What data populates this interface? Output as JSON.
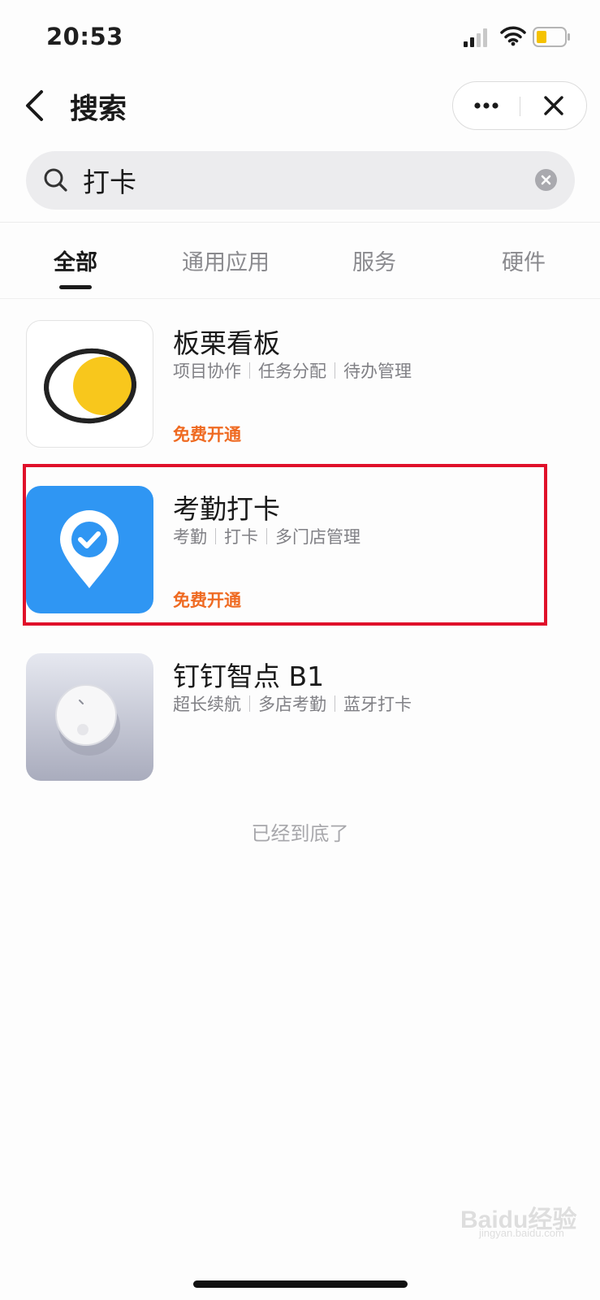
{
  "status_bar": {
    "time": "20:53",
    "battery_color": "#f5c200"
  },
  "nav": {
    "title": "搜索",
    "more_icon": "ellipsis-icon",
    "close_icon": "close-icon"
  },
  "search": {
    "query": "打卡",
    "placeholder": ""
  },
  "tabs": [
    {
      "label": "全部",
      "active": true
    },
    {
      "label": "通用应用",
      "active": false
    },
    {
      "label": "服务",
      "active": false
    },
    {
      "label": "硬件",
      "active": false
    }
  ],
  "results": [
    {
      "name": "板栗看板",
      "tags": [
        "项目协作",
        "任务分配",
        "待办管理"
      ],
      "action": "免费开通",
      "icon": "egg-logo-icon",
      "highlighted": false
    },
    {
      "name": "考勤打卡",
      "tags": [
        "考勤",
        "打卡",
        "多门店管理"
      ],
      "action": "免费开通",
      "icon": "location-check-icon",
      "highlighted": true
    },
    {
      "name": "钉钉智点 B1",
      "tags": [
        "超长续航",
        "多店考勤",
        "蓝牙打卡"
      ],
      "action": "",
      "icon": "device-button-icon",
      "highlighted": false
    }
  ],
  "end_text": "已经到底了",
  "watermark": {
    "text": "Baidu经验",
    "sub": "jingyan.baidu.com"
  },
  "colors": {
    "accent_orange": "#ef6a21",
    "highlight_red": "#e0102a",
    "app_blue": "#2f96f3",
    "egg_yellow": "#f8c71c"
  }
}
